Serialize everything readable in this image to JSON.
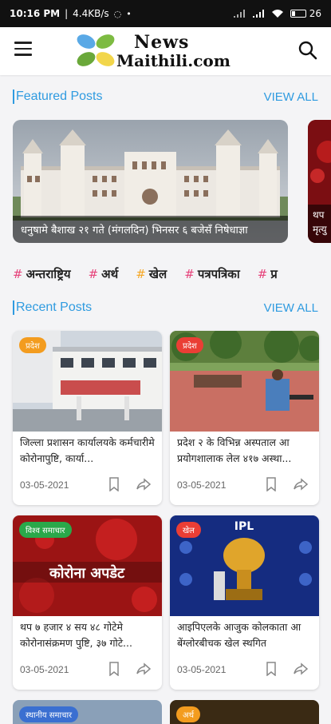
{
  "status_bar": {
    "time": "10:16 PM",
    "speed": "4.4KB/s",
    "battery": "26"
  },
  "app": {
    "logo_line1": "News",
    "logo_line2": "Maithili.com"
  },
  "featured": {
    "section_title": "Featured Posts",
    "view_all": "VIEW ALL",
    "items": [
      {
        "caption": "धनुषामे बैशाख २१ गते (मंगलदिन) भिनसर ६ बजेसँ निषेधाज्ञा"
      },
      {
        "caption": "थप मृत्यु"
      }
    ]
  },
  "tags": [
    {
      "hash": "#",
      "label": "अन्तराष्ट्रिय",
      "hash_color": "#e6427a"
    },
    {
      "hash": "#",
      "label": "अर्थ",
      "hash_color": "#e6427a"
    },
    {
      "hash": "#",
      "label": "खेल",
      "hash_color": "#f5a623"
    },
    {
      "hash": "#",
      "label": "पत्रपत्रिका",
      "hash_color": "#e6427a"
    },
    {
      "hash": "#",
      "label": "प्र",
      "hash_color": "#e6427a"
    }
  ],
  "recent": {
    "section_title": "Recent Posts",
    "view_all": "VIEW ALL",
    "posts": [
      {
        "badge": "प्रदेश",
        "badge_color": "#f39c1f",
        "title": "जिल्ला प्रशासन कार्यालयके कर्मचारीमे कोरोनापुष्टि, कार्या...",
        "date": "03-05-2021"
      },
      {
        "badge": "प्रदेश",
        "badge_color": "#ea3e35",
        "title": "प्रदेश २ के विभिन्न अस्पताल आ प्रयोगशालाक लेल ४१७ अस्था...",
        "date": "03-05-2021"
      },
      {
        "badge": "विश्व समाचार",
        "badge_color": "#2aa84a",
        "title": "थप ७ हजार ४ सय ४८ गोटेमे कोरोनासंक्रमण पुष्टि, ३७ गोटे...",
        "date": "03-05-2021"
      },
      {
        "badge": "खेल",
        "badge_color": "#ea3e35",
        "title": "आइपिएलके आजुक कोलकाता आ बेंग्लोरबीचक खेल स्थगित",
        "date": "03-05-2021"
      }
    ],
    "more": [
      {
        "badge": "स्थानीय समाचार"
      },
      {
        "badge": "अर्थ"
      }
    ]
  },
  "card_images": {
    "img3_text": "कोरोना अपडेट",
    "img4_text": "IPL"
  },
  "colors": {
    "accent": "#2f9be0"
  }
}
